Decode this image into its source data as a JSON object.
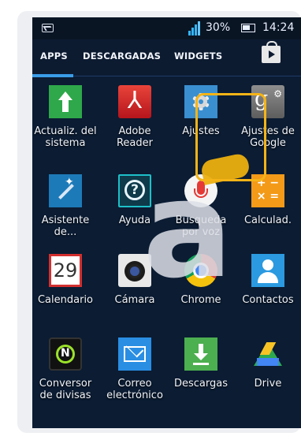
{
  "status_bar": {
    "network_type": "3G",
    "battery_percent": "30%",
    "time": "14:24"
  },
  "tabs": [
    {
      "label": "APPS",
      "active": true
    },
    {
      "label": "DESCARGADAS",
      "active": false
    },
    {
      "label": "WIDGETS",
      "active": false
    }
  ],
  "apps": [
    {
      "label": "Actualiz. del sistema",
      "icon": "system-update-icon"
    },
    {
      "label": "Adobe Reader",
      "icon": "adobe-reader-icon",
      "glyph": "⅄"
    },
    {
      "label": "Ajustes",
      "icon": "settings-gear-icon",
      "highlighted": true
    },
    {
      "label": "Ajustes de Google",
      "icon": "google-settings-icon",
      "glyph": "g",
      "glyph2": "⚙"
    },
    {
      "label": "Asistente de...",
      "icon": "setup-wizard-icon"
    },
    {
      "label": "Ayuda",
      "icon": "help-icon",
      "glyph": "?"
    },
    {
      "label": "Busqueda por voz",
      "icon": "voice-search-mic-icon"
    },
    {
      "label": "Calculad.",
      "icon": "calculator-icon",
      "glyph": "+ −\n× ="
    },
    {
      "label": "Calendario",
      "icon": "calendar-icon",
      "glyph": "29"
    },
    {
      "label": "Cámara",
      "icon": "camera-icon"
    },
    {
      "label": "Chrome",
      "icon": "chrome-icon"
    },
    {
      "label": "Contactos",
      "icon": "contacts-icon"
    },
    {
      "label": "Conversor de divisas",
      "icon": "currency-converter-icon"
    },
    {
      "label": "Correo electrónico",
      "icon": "email-icon"
    },
    {
      "label": "Descargas",
      "icon": "downloads-icon"
    },
    {
      "label": "Drive",
      "icon": "drive-icon"
    }
  ],
  "colors": {
    "highlight": "#f5b417",
    "tab_indicator": "#3a9de8",
    "screen_bg": "#0b1c33"
  }
}
